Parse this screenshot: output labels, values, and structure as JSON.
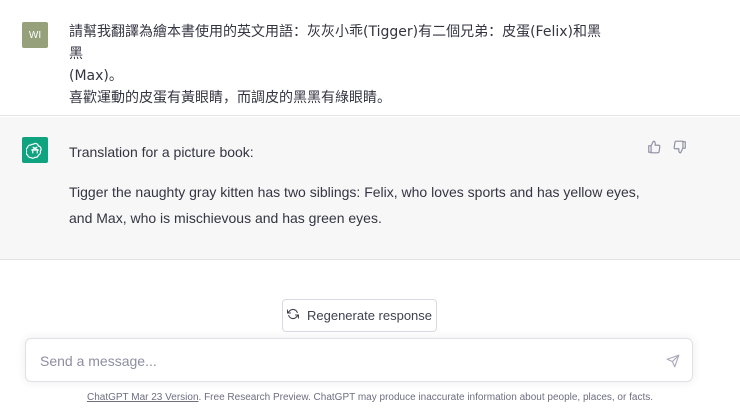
{
  "user_message": {
    "avatar_initials": "WI",
    "line1": "請幫我翻譯為繪本書使用的英文用語：灰灰小乖(Tigger)有二個兄弟：皮蛋(Felix)和黑黑",
    "line2": "(Max)。",
    "line3": "喜歡運動的皮蛋有黃眼睛，而調皮的黑黑有綠眼睛。"
  },
  "ai_message": {
    "avatar_icon": "openai-logo-icon",
    "heading": "Translation for a picture book:",
    "line1": "Tigger the naughty gray kitten has two siblings: Felix, who loves sports and has yellow eyes,",
    "line2": "and Max, who is mischievous and has green eyes."
  },
  "feedback": {
    "like_icon": "thumbs-up-icon",
    "dislike_icon": "thumbs-down-icon"
  },
  "regenerate": {
    "label": "Regenerate response",
    "icon": "refresh-icon"
  },
  "composer": {
    "placeholder": "Send a message...",
    "send_icon": "send-icon"
  },
  "footer": {
    "version_link": "ChatGPT Mar 23 Version",
    "text": ". Free Research Preview. ChatGPT may produce inaccurate information about people, places, or facts."
  },
  "colors": {
    "ai_bg": "#f7f7f8",
    "openai_green": "#10a37f",
    "user_avatar": "#96a07b",
    "text": "#343541"
  }
}
